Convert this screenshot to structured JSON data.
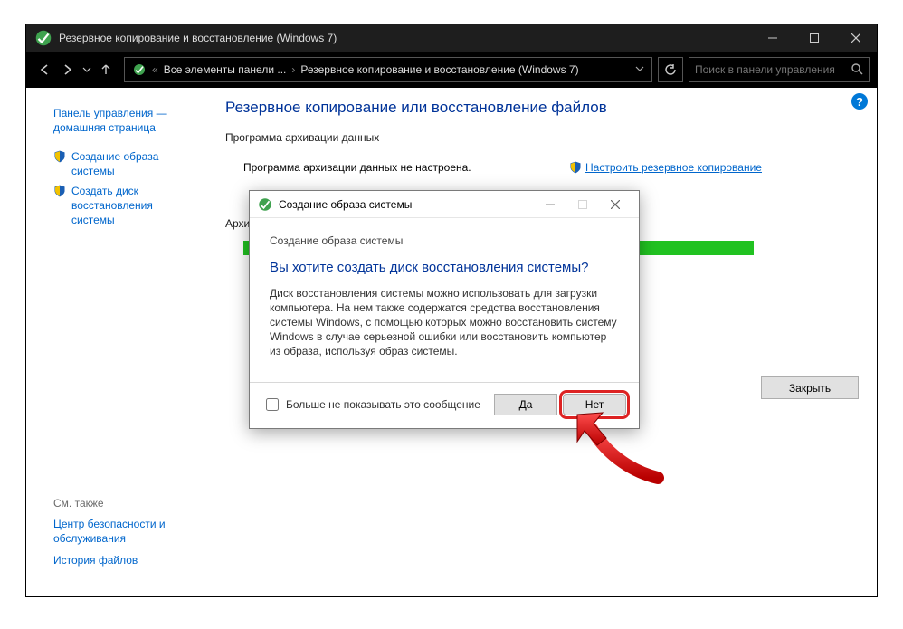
{
  "window": {
    "title": "Резервное копирование и восстановление (Windows 7)"
  },
  "nav": {
    "crumb1": "Все элементы панели ...",
    "crumb2": "Резервное копирование и восстановление (Windows 7)",
    "search_placeholder": "Поиск в панели управления"
  },
  "sidebar": {
    "home_line1": "Панель управления —",
    "home_line2": "домашняя страница",
    "link_image": "Создание образа системы",
    "link_disc_line1": "Создать диск восстановления",
    "link_disc_line2": "системы",
    "see_also_hdr": "См. также",
    "see_also_1a": "Центр безопасности и",
    "see_also_1b": "обслуживания",
    "see_also_2": "История файлов"
  },
  "main": {
    "title": "Резервное копирование или восстановление файлов",
    "section_backup": "Программа архивации данных",
    "status_not_configured": "Программа архивации данных не настроена.",
    "configure_link": "Настроить резервное копирование",
    "section_archive": "Архива",
    "close_btn": "Закрыть"
  },
  "dialog": {
    "title": "Создание образа системы",
    "instruction": "Создание образа системы",
    "question": "Вы хотите создать диск восстановления системы?",
    "body": "Диск восстановления системы можно использовать для загрузки компьютера. На нем также содержатся средства восстановления системы Windows, с помощью которых можно восстановить систему Windows в случае серьезной ошибки или восстановить компьютер из образа, используя образ системы.",
    "checkbox_label": "Больше не показывать это сообщение",
    "yes": "Да",
    "no": "Нет"
  }
}
